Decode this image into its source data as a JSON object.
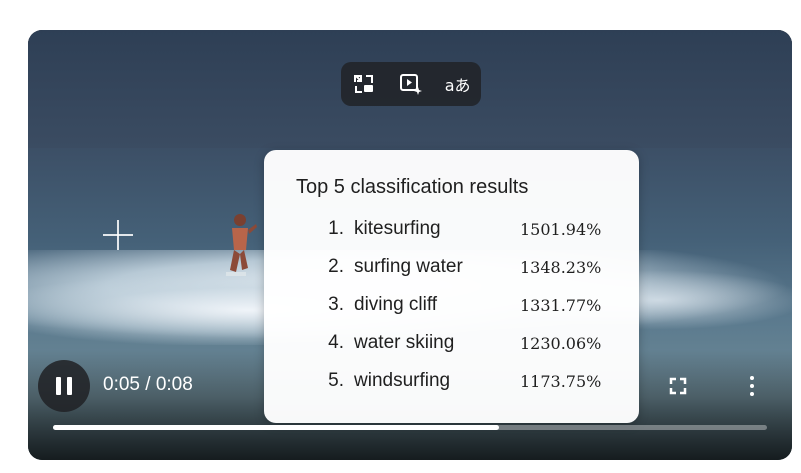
{
  "toolbar": {
    "icons": [
      "picture-in-picture-exit-icon",
      "video-sparkle-icon",
      "translate-icon"
    ],
    "glyphs": [
      "⤡",
      "▶",
      "aあ"
    ]
  },
  "results": {
    "title": "Top 5 classification results",
    "items": [
      {
        "rank": "1.",
        "label": "kitesurfing",
        "score": "1501.94%"
      },
      {
        "rank": "2.",
        "label": "surfing water",
        "score": "1348.23%"
      },
      {
        "rank": "3.",
        "label": "diving cliff",
        "score": "1331.77%"
      },
      {
        "rank": "4.",
        "label": "water skiing",
        "score": "1230.06%"
      },
      {
        "rank": "5.",
        "label": "windsurfing",
        "score": "1173.75%"
      }
    ]
  },
  "player": {
    "time": "0:05 / 0:08",
    "progress_fraction": 0.625
  }
}
